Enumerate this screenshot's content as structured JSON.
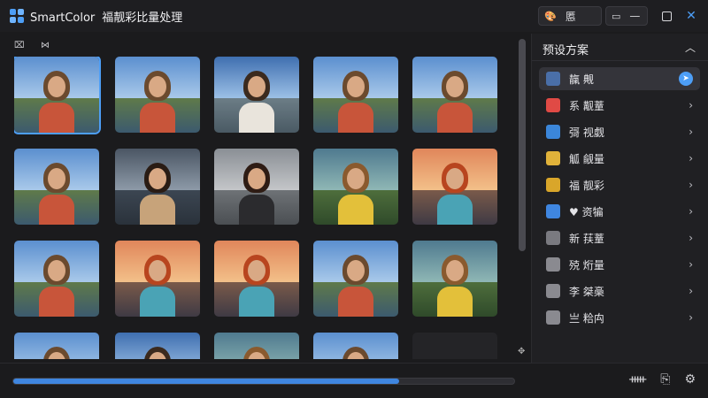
{
  "app": {
    "name": "SmartColor",
    "subtitle": "福靓彩比量处理"
  },
  "titlebar": {
    "tab_label": "慝",
    "minimize": "—",
    "close": "✕"
  },
  "presets_panel": {
    "title": "预设方案",
    "items": [
      {
        "label": "靝 觍",
        "color": "#4a6fa8",
        "active": true
      },
      {
        "label": "系 觏蕫",
        "color": "#e04a45"
      },
      {
        "label": "彁 视觑",
        "color": "#3b86d9"
      },
      {
        "label": "觚 觎量",
        "color": "#e0b23a"
      },
      {
        "label": "福 靓彩",
        "color": "#d9a62a"
      },
      {
        "label": "♥ 资犏",
        "color": "#3f86e0"
      },
      {
        "label": "新 荴蕫",
        "color": "#7a7a80"
      },
      {
        "label": "殑 烆量",
        "color": "#8a8a90"
      },
      {
        "label": "李 桀槀",
        "color": "#8a8a90"
      },
      {
        "label": "亗 粭禸",
        "color": "#8a8a90"
      }
    ]
  },
  "progress": 0.77,
  "colors": {
    "accent": "#4d9ef6",
    "panel": "#202023",
    "background": "#1b1b1d"
  },
  "thumbnails": [
    {
      "scene": "lake",
      "sel": true
    },
    {
      "scene": "lake"
    },
    {
      "scene": "sky"
    },
    {
      "scene": "lake"
    },
    {
      "scene": "lake"
    },
    {
      "scene": "lake"
    },
    {
      "scene": "storm"
    },
    {
      "scene": "grey"
    },
    {
      "scene": "forest"
    },
    {
      "scene": "sunset"
    },
    {
      "scene": "lake"
    },
    {
      "scene": "sunset"
    },
    {
      "scene": "sunset"
    },
    {
      "scene": "lake"
    },
    {
      "scene": "forest"
    },
    {
      "scene": "lake"
    },
    {
      "scene": "sky"
    },
    {
      "scene": "forest"
    },
    {
      "scene": "lake"
    },
    {
      "scene": "empty"
    }
  ]
}
